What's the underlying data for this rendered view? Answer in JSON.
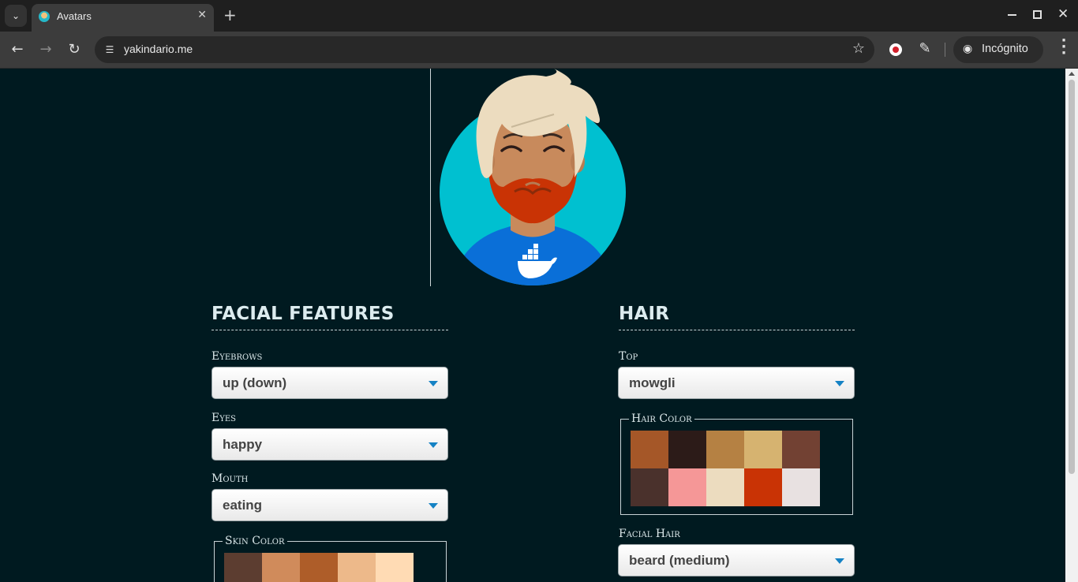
{
  "browser": {
    "tab_title": "Avatars",
    "url": "yakindario.me",
    "incognito_label": "Incógnito",
    "icons": [
      "tab-search-icon",
      "close-icon",
      "plus-icon",
      "minimize-icon",
      "restore-icon",
      "window-close-icon",
      "back-icon",
      "forward-icon",
      "reload-icon",
      "site-info-icon",
      "star-icon",
      "record-extension-icon",
      "puzzle-icon",
      "incognito-icon",
      "kebab-menu-icon"
    ]
  },
  "facial_features": {
    "title": "FACIAL FEATURES",
    "eyebrows": {
      "label": "Eyebrows",
      "value": "up (down)"
    },
    "eyes": {
      "label": "Eyes",
      "value": "happy"
    },
    "mouth": {
      "label": "Mouth",
      "value": "eating"
    },
    "skin_color": {
      "label": "Skin Color",
      "swatches": [
        "#5c3d30",
        "#d08b5b",
        "#ae5d29",
        "#edb98a",
        "#ffdbb4"
      ]
    }
  },
  "hair": {
    "title": "HAIR",
    "top": {
      "label": "Top",
      "value": "mowgli"
    },
    "hair_color": {
      "label": "Hair Color",
      "swatches": [
        "#a55728",
        "#2c1b18",
        "#b58143",
        "#d6b370",
        "#724133",
        "#4a312c",
        "#f59797",
        "#ecdcbf",
        "#c93305",
        "#e8e1e1"
      ]
    },
    "facial_hair": {
      "label": "Facial Hair",
      "value": "beard (medium)"
    }
  },
  "colors": {
    "page_bg": "#001a20",
    "accent": "#1582c4",
    "avatar_bg": "#00c0d0",
    "shirt": "#0a6fd8"
  }
}
